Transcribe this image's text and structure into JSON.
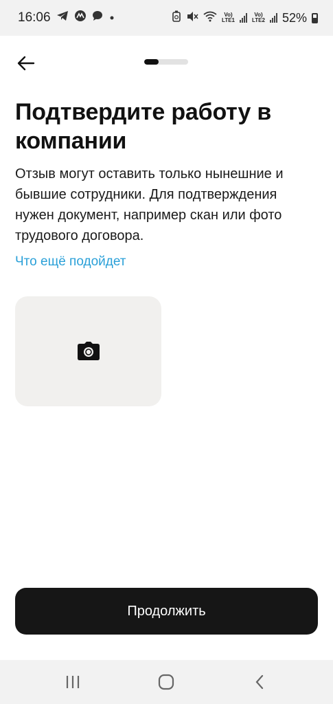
{
  "status_bar": {
    "time": "16:06",
    "battery_text": "52%",
    "sim1_top": "Vo)",
    "sim1_bottom": "LTE1",
    "sim2_top": "Vo)",
    "sim2_bottom": "LTE2",
    "icons": [
      "telegram-icon",
      "app-icon",
      "chat-icon",
      "dot-icon",
      "recycle-icon",
      "mute-icon",
      "wifi-icon",
      "signal-icon",
      "battery-icon"
    ]
  },
  "header": {
    "back_icon": "arrow-left-icon",
    "progress": 0.33
  },
  "main": {
    "title": "Подтвердите работу в компании",
    "description": "Отзыв могут оставить только нынешние и бывшие сотрудники. Для подтверждения нужен документ, например скан или фото трудового договора.",
    "link_text": "Что ещё подойдет",
    "upload_icon": "camera-icon"
  },
  "footer": {
    "continue_label": "Продолжить"
  },
  "nav_bar": {
    "items": [
      "recents-icon",
      "home-icon",
      "back-icon"
    ]
  },
  "colors": {
    "accent_link": "#2aa0d8",
    "button_bg": "#161616",
    "upload_bg": "#f1f0ee"
  }
}
